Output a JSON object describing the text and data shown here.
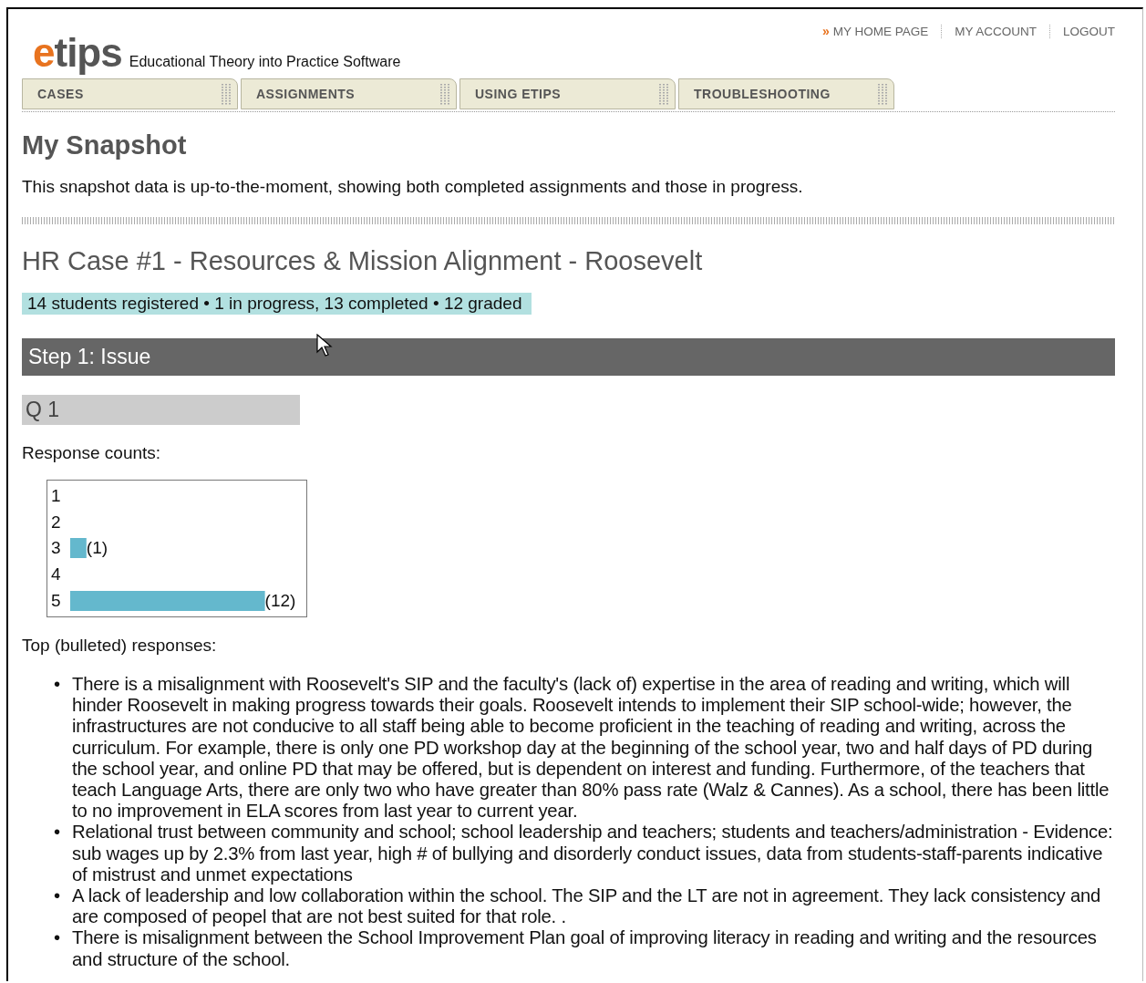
{
  "top_links": [
    {
      "marker": "»",
      "label": "MY HOME PAGE",
      "current": true
    },
    {
      "label": "MY ACCOUNT",
      "current": false
    },
    {
      "label": "LOGOUT",
      "current": false
    }
  ],
  "logo": {
    "mark": "etips",
    "tagline": "Educational Theory into Practice Software"
  },
  "tabs": [
    {
      "label": "CASES"
    },
    {
      "label": "ASSIGNMENTS"
    },
    {
      "label": "USING ETIPS"
    },
    {
      "label": "TROUBLESHOOTING"
    }
  ],
  "page_title": "My Snapshot",
  "intro": "This snapshot data is up-to-the-moment, showing both completed assignments and those in progress.",
  "case_title": "HR Case #1 - Resources & Mission Alignment - Roosevelt",
  "stats": "14 students registered • 1 in progress, 13 completed • 12 graded",
  "step": "Step 1: Issue",
  "question": "Q 1",
  "counts_label": "Response counts:",
  "chart_data": {
    "type": "bar",
    "orientation": "horizontal",
    "categories": [
      "1",
      "2",
      "3",
      "4",
      "5"
    ],
    "series": [
      {
        "color": "#64b8cd",
        "values": [
          null,
          null,
          1,
          null,
          12
        ]
      }
    ],
    "data_labels": true
  },
  "value_label_brackets": [
    "(",
    ")"
  ],
  "responses_label": "Top (bulleted) responses:",
  "bullet": "•",
  "responses": [
    "There is a misalignment with Roosevelt's SIP and the faculty's (lack of) expertise in the area of reading and writing, which will hinder Roosevelt in making progress towards their goals. Roosevelt intends to implement their SIP school-wide; however, the infrastructures are not conducive to all staff being able to become proficient in the teaching of reading and writing, across the curriculum. For example, there is only one PD workshop day at the beginning of the school year, two and half days of PD during the school year, and online PD that may be offered, but is dependent on interest and funding. Furthermore, of the teachers that teach Language Arts, there are only two who have greater than 80% pass rate (Walz & Cannes). As a school, there has been little to no improvement in ELA scores from last year to current year.",
    "Relational trust between community and school; school leadership and teachers; students and teachers/administration - Evidence: sub wages up by 2.3% from last year, high # of bullying and disorderly conduct issues, data from students-staff-parents indicative of mistrust and unmet expectations",
    "A lack of leadership and low collaboration within the school. The SIP and the LT are not in agreement. They lack consistency and are composed of peopel that are not best suited for that role. .",
    "There is misalignment between the School Improvement Plan goal of improving literacy in reading and writing and the resources and structure of the school."
  ]
}
